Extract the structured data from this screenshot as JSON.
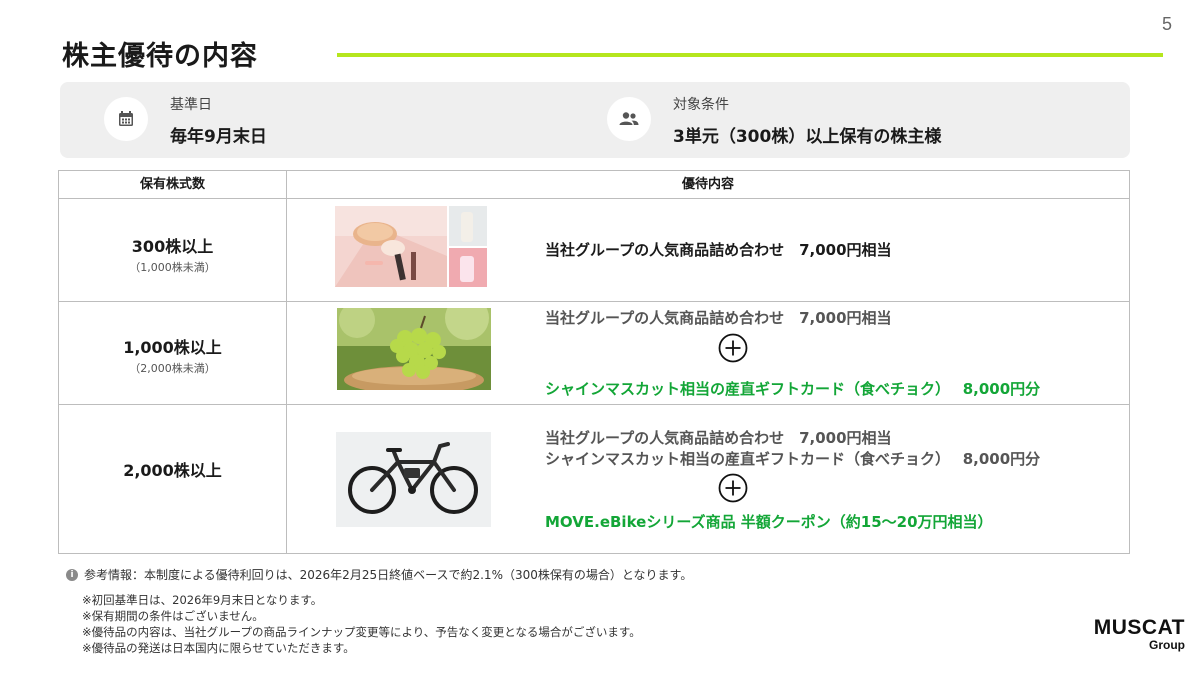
{
  "page_number": "5",
  "title": "株主優待の内容",
  "info": {
    "base_date_label": "基準日",
    "base_date_value": "毎年9月末日",
    "eligibility_label": "対象条件",
    "eligibility_value": "3単元（300株）以上保有の株主様"
  },
  "table": {
    "headers": [
      "保有株式数",
      "優待内容"
    ],
    "rows": [
      {
        "qty": "300株以上",
        "qty_sub": "（1,000株未満）",
        "items": [
          "当社グループの人気商品詰め合わせ　7,000円相当"
        ]
      },
      {
        "qty": "1,000株以上",
        "qty_sub": "（2,000株未満）",
        "items": [
          "当社グループの人気商品詰め合わせ　7,000円相当",
          "シャインマスカット相当の産直ギフトカード（食べチョク）　 8,000円分"
        ]
      },
      {
        "qty": "2,000株以上",
        "qty_sub": "",
        "items": [
          "当社グループの人気商品詰め合わせ　7,000円相当",
          "シャインマスカット相当の産直ギフトカード（食べチョク）　 8,000円分",
          "MOVE.eBikeシリーズ商品 半額クーポン（約15～20万円相当）"
        ]
      }
    ]
  },
  "reference_note": "参考情報：本制度による優待利回りは、2026年2月25日終値ベースで約2.1%（300株保有の場合）となります。",
  "notes": [
    "※初回基準日は、2026年9月末日となります。",
    "※保有期間の条件はございません。",
    "※優待品の内容は、当社グループの商品ラインナップ変更等により、予告なく変更となる場合がございます。",
    "※優待品の発送は日本国内に限らせていただきます。"
  ],
  "logo": {
    "main": "MUSCAT",
    "sub": "Group"
  },
  "colors": {
    "accent_line": "#b5e61d",
    "green_text": "#13a637",
    "info_bg": "#efefef"
  },
  "icons": [
    "calendar-icon",
    "people-icon",
    "plus-circle-icon",
    "info-icon"
  ]
}
